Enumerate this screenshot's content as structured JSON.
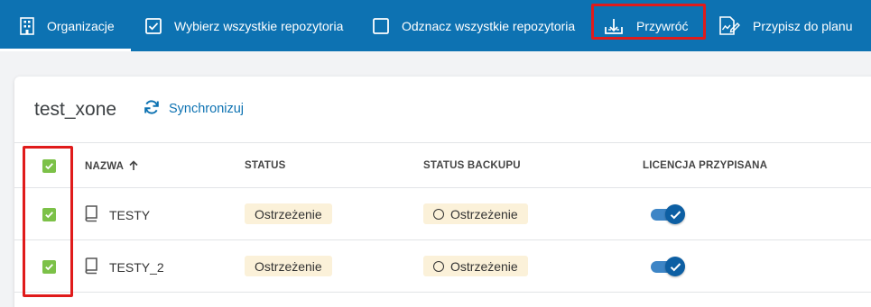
{
  "toolbar": {
    "items": [
      {
        "label": "Organizacje",
        "icon": "building-icon"
      },
      {
        "label": "Wybierz wszystkie repozytoria",
        "icon": "checked-box-icon"
      },
      {
        "label": "Odznacz wszystkie repozytoria",
        "icon": "empty-box-icon"
      },
      {
        "label": "Przywróć",
        "icon": "restore-icon"
      },
      {
        "label": "Przypisz do planu",
        "icon": "assign-plan-icon"
      }
    ],
    "active_index": 0,
    "highlighted_index": 3
  },
  "repo": {
    "title": "test_xone",
    "sync_label": "Synchronizuj"
  },
  "table": {
    "headers": {
      "name": "NAZWA",
      "status": "STATUS",
      "backup": "STATUS BACKUPU",
      "license": "LICENCJA PRZYPISANA"
    },
    "sort_icon": "arrow-up-icon",
    "rows": [
      {
        "name": "TESTY",
        "status": "Ostrzeżenie",
        "backup_status": "Ostrzeżenie",
        "selected": true,
        "license_assigned": true
      },
      {
        "name": "TESTY_2",
        "status": "Ostrzeżenie",
        "backup_status": "Ostrzeżenie",
        "selected": true,
        "license_assigned": true
      }
    ]
  },
  "colors": {
    "toolbar_bg": "#0d72b2",
    "checkbox_green": "#7cc148",
    "badge_bg": "#fbf1d9",
    "highlight_red": "#e01b1b",
    "toggle_blue": "#0d5fa3"
  }
}
